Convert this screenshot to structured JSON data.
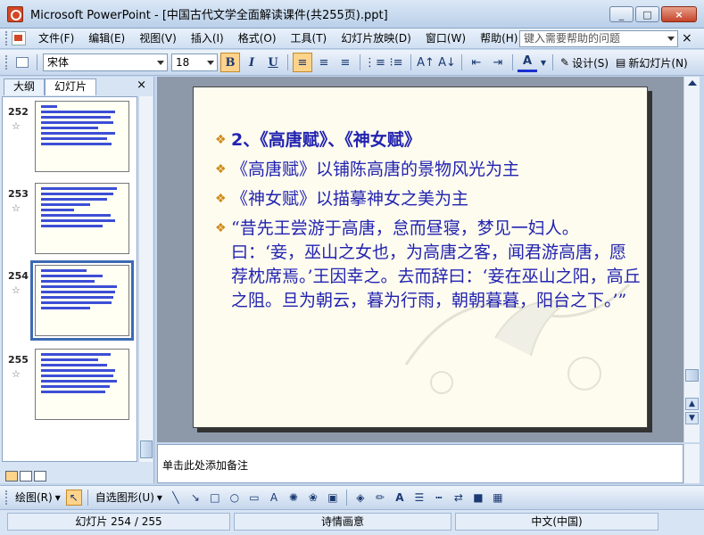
{
  "window": {
    "title": "Microsoft PowerPoint - [中国古代文学全面解读课件(共255页).ppt]",
    "buttons": [
      "_",
      "□",
      "×"
    ]
  },
  "menu": {
    "items": [
      "文件(F)",
      "编辑(E)",
      "视图(V)",
      "插入(I)",
      "格式(O)",
      "工具(T)",
      "幻灯片放映(D)",
      "窗口(W)",
      "帮助(H)"
    ],
    "help_placeholder": "键入需要帮助的问题",
    "close": "×"
  },
  "toolbar": {
    "font": "宋体",
    "size": "18",
    "bold": "B",
    "italic": "I",
    "underline": "U",
    "design_label": "设计(S)",
    "new_slide_label": "新幻灯片(N)"
  },
  "left_pane": {
    "tabs": [
      "大纲",
      "幻灯片"
    ],
    "close": "×",
    "thumbnails": [
      {
        "number": "252",
        "star": "☆"
      },
      {
        "number": "253",
        "star": "☆"
      },
      {
        "number": "254",
        "star": "☆"
      },
      {
        "number": "255",
        "star": "☆"
      }
    ]
  },
  "slide": {
    "bullets": [
      "2、《高唐赋》、《神女赋》",
      "《高唐赋》以铺陈高唐的景物风光为主",
      "《神女赋》以描摹神女之美为主",
      "“昔先王尝游于高唐，怠而昼寝，梦见一妇人。曰：‘妾，巫山之女也，为高唐之客，闻君游高唐，愿荐枕席焉。’王因幸之。去而辞曰：‘妾在巫山之阳，高丘之阻。旦为朝云，暮为行雨，朝朝暮暮，阳台之下。’”"
    ],
    "bullet_symbol": "❖",
    "colors": {
      "text": "#2222b0",
      "bullet": "#cf8a18",
      "background": "#fdfcef"
    }
  },
  "notes": {
    "placeholder": "单击此处添加备注"
  },
  "drawbar": {
    "draw_label": "绘图(R)",
    "autoshapes_label": "自选图形(U)"
  },
  "status": {
    "slide_info": "幻灯片 254 / 255",
    "design": "诗情画意",
    "language": "中文(中国)"
  }
}
